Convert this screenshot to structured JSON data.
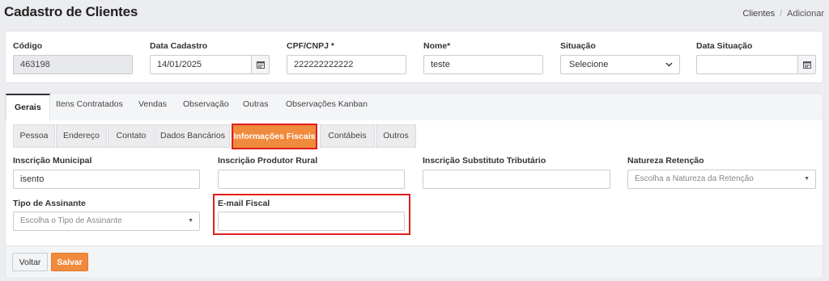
{
  "page": {
    "title": "Cadastro de Clientes"
  },
  "breadcrumb": {
    "items": [
      "Clientes",
      "Adicionar"
    ],
    "separator": "/"
  },
  "header_fields": {
    "codigo": {
      "label": "Código",
      "value": "463198"
    },
    "data_cadastro": {
      "label": "Data Cadastro",
      "value": "14/01/2025"
    },
    "cpf_cnpj": {
      "label": "CPF/CNPJ *",
      "value": "222222222222"
    },
    "nome": {
      "label": "Nome*",
      "value": "teste"
    },
    "situacao": {
      "label": "Situação",
      "value": "Selecione"
    },
    "data_situacao": {
      "label": "Data Situação",
      "value": ""
    }
  },
  "tabs": [
    "Gerais",
    "Itens Contratados",
    "Vendas",
    "Observação",
    "Outras",
    "Observações Kanban"
  ],
  "active_tab": "Gerais",
  "subtabs": [
    "Pessoa",
    "Endereço",
    "Contato",
    "Dados Bancários",
    "Informações Fiscais",
    "Contábeis",
    "Outros"
  ],
  "active_subtab": "Informações Fiscais",
  "fiscal": {
    "inscricao_municipal": {
      "label": "Inscrição Municipal",
      "value": "isento"
    },
    "inscricao_produtor_rural": {
      "label": "Inscrição Produtor Rural",
      "value": ""
    },
    "inscricao_substituto": {
      "label": "Inscrição Substituto Tributário",
      "value": ""
    },
    "natureza_retencao": {
      "label": "Natureza Retenção",
      "placeholder": "Escolha a Natureza da Retenção"
    },
    "tipo_assinante": {
      "label": "Tipo de Assinante",
      "placeholder": "Escolha o Tipo de Assinante"
    },
    "email_fiscal": {
      "label": "E-mail Fiscal",
      "value": ""
    }
  },
  "buttons": {
    "back": "Voltar",
    "save": "Salvar"
  },
  "colors": {
    "accent": "#f08a3c",
    "highlight": "#e01d1d",
    "background": "#ecedf1"
  },
  "icons": {
    "calendar": "calendar-icon",
    "select_chevron": "chevron-down-icon",
    "select2_caret": "caret-down-icon"
  }
}
